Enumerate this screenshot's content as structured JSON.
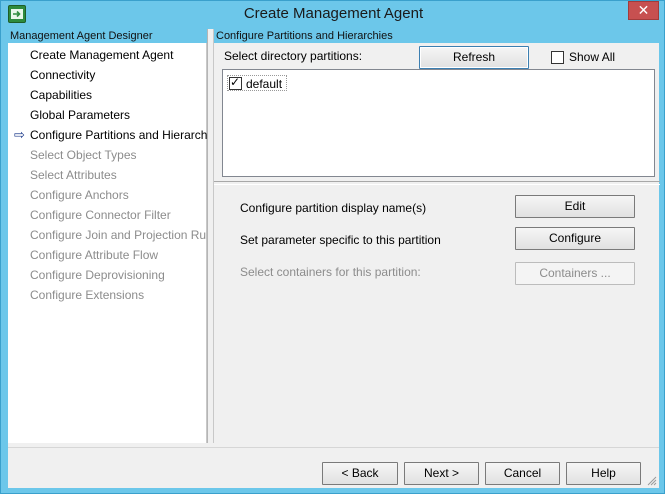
{
  "window": {
    "title": "Create Management Agent",
    "close_label": "✕"
  },
  "left_panel": {
    "header": "Management Agent Designer",
    "items": [
      {
        "label": "Create Management Agent",
        "enabled": true,
        "current": false
      },
      {
        "label": "Connectivity",
        "enabled": true,
        "current": false
      },
      {
        "label": "Capabilities",
        "enabled": true,
        "current": false
      },
      {
        "label": "Global Parameters",
        "enabled": true,
        "current": false
      },
      {
        "label": "Configure Partitions and Hierarchies",
        "enabled": true,
        "current": true
      },
      {
        "label": "Select Object Types",
        "enabled": false,
        "current": false
      },
      {
        "label": "Select Attributes",
        "enabled": false,
        "current": false
      },
      {
        "label": "Configure Anchors",
        "enabled": false,
        "current": false
      },
      {
        "label": "Configure Connector Filter",
        "enabled": false,
        "current": false
      },
      {
        "label": "Configure Join and Projection Rules",
        "enabled": false,
        "current": false
      },
      {
        "label": "Configure Attribute Flow",
        "enabled": false,
        "current": false
      },
      {
        "label": "Configure Deprovisioning",
        "enabled": false,
        "current": false
      },
      {
        "label": "Configure Extensions",
        "enabled": false,
        "current": false
      }
    ]
  },
  "right_panel": {
    "header": "Configure Partitions and Hierarchies",
    "select_label": "Select directory partitions:",
    "refresh_label": "Refresh",
    "show_all_label": "Show All",
    "show_all_checked": false,
    "partitions": [
      {
        "label": "default",
        "checked": true
      }
    ],
    "display_name_label": "Configure partition display name(s)",
    "edit_label": "Edit",
    "param_label": "Set parameter specific to this partition",
    "configure_label": "Configure",
    "containers_text": "Select containers for this partition:",
    "containers_button": "Containers ..."
  },
  "footer": {
    "back": "< Back",
    "next": "Next >",
    "cancel": "Cancel",
    "help": "Help"
  },
  "icons": {
    "arrow": "current-step-arrow-icon",
    "check": "checkmark-icon",
    "app": "app-icon",
    "grip": "resize-grip-icon"
  },
  "colors": {
    "title_bar": "#6cc7ea",
    "close_button": "#c75050",
    "disabled_text": "#8c8c8c",
    "arrow": "#1c3a8a"
  }
}
